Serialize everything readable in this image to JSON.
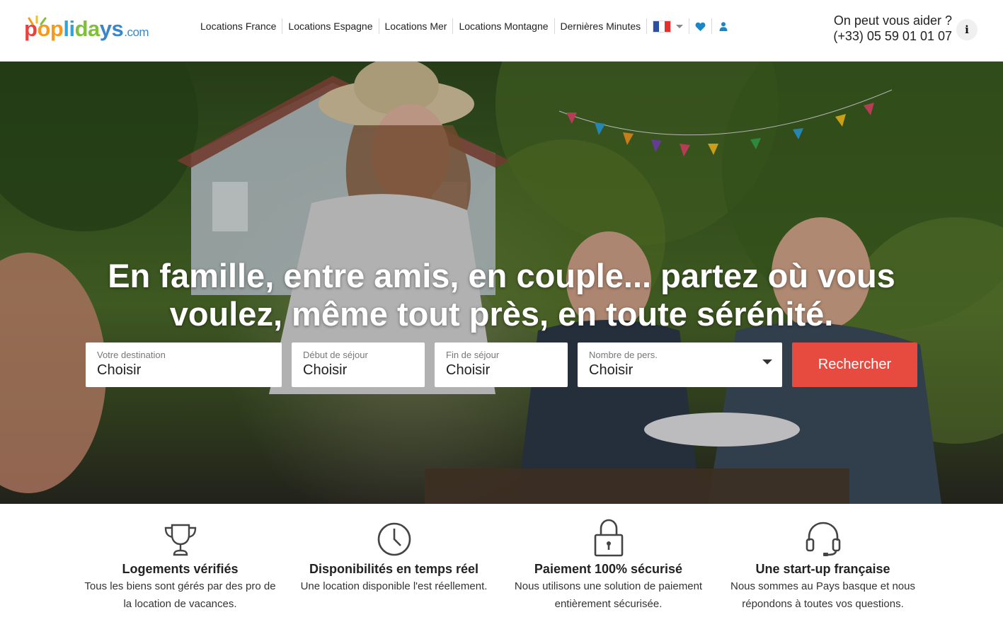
{
  "brand": {
    "logo_letters": [
      "p",
      "o",
      "p",
      "l",
      "i",
      "d",
      "a",
      "y",
      "s"
    ],
    "logo_suffix": ".com",
    "colors": {
      "red": "#e8423f",
      "orange": "#f59a1b",
      "cyan": "#2fa4d8",
      "green": "#7fbf3a",
      "blue": "#3a86c8"
    }
  },
  "nav": {
    "links": [
      "Locations France",
      "Locations Espagne",
      "Locations Mer",
      "Locations Montagne",
      "Dernières Minutes"
    ],
    "language_flag": "france-flag-icon",
    "favorites_icon": "heart-icon",
    "account_icon": "user-icon"
  },
  "help": {
    "title": "On peut vous aider ?",
    "phone": "(+33) 05 59 01 01 07",
    "info_label": "i"
  },
  "hero": {
    "title_line1": "En famille, entre amis, en couple... partez où vous",
    "title_line2": "voulez, même tout près, en toute sérénité."
  },
  "search": {
    "destination": {
      "label": "Votre destination",
      "value": "Choisir"
    },
    "start": {
      "label": "Début de séjour",
      "value": "Choisir"
    },
    "end": {
      "label": "Fin de séjour",
      "value": "Choisir"
    },
    "people": {
      "label": "Nombre de pers.",
      "value": "Choisir"
    },
    "button": "Rechercher",
    "button_color": "#e74b40"
  },
  "features": [
    {
      "icon": "trophy-icon",
      "title": "Logements vérifiés",
      "text": "Tous les biens sont gérés par des pro de la location de vacances."
    },
    {
      "icon": "clock-icon",
      "title": "Disponibilités en temps réel",
      "text": "Une location disponible l'est réellement."
    },
    {
      "icon": "lock-icon",
      "title": "Paiement 100% sécurisé",
      "text": "Nous utilisons une solution de paiement entièrement sécurisée."
    },
    {
      "icon": "headset-icon",
      "title": "Une start-up française",
      "text": "Nous sommes au Pays basque et nous répondons à toutes vos questions."
    }
  ]
}
